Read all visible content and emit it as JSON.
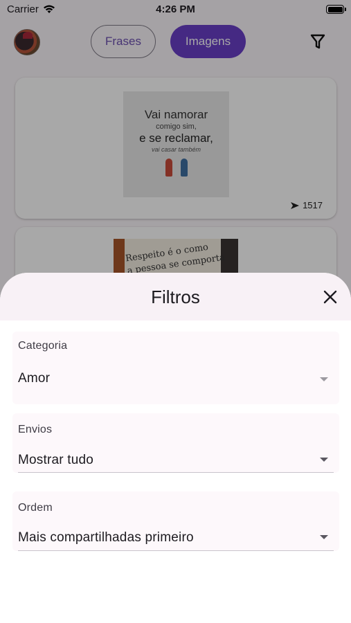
{
  "status_bar": {
    "carrier": "Carrier",
    "time": "4:26 PM"
  },
  "header": {
    "tabs": [
      {
        "label": "Frases",
        "selected": false
      },
      {
        "label": "Imagens",
        "selected": true
      }
    ]
  },
  "feed": {
    "posts": [
      {
        "image_text": [
          "Vai namorar",
          "comigo sim,",
          "e se reclamar,",
          "vai casar também"
        ],
        "share_count": "1517"
      },
      {
        "image_text": [
          "Respeito é o como",
          "a pessoa se comporta"
        ]
      }
    ]
  },
  "filter_sheet": {
    "title": "Filtros",
    "fields": [
      {
        "label": "Categoria",
        "value": "Amor",
        "enabled": false
      },
      {
        "label": "Envios",
        "value": "Mostrar tudo",
        "enabled": true
      },
      {
        "label": "Ordem",
        "value": "Mais compartilhadas primeiro",
        "enabled": true
      }
    ]
  },
  "colors": {
    "accent": "#6a3fc7",
    "sheet_header": "#f8f1f6",
    "field_bg": "#fdf8fb"
  }
}
